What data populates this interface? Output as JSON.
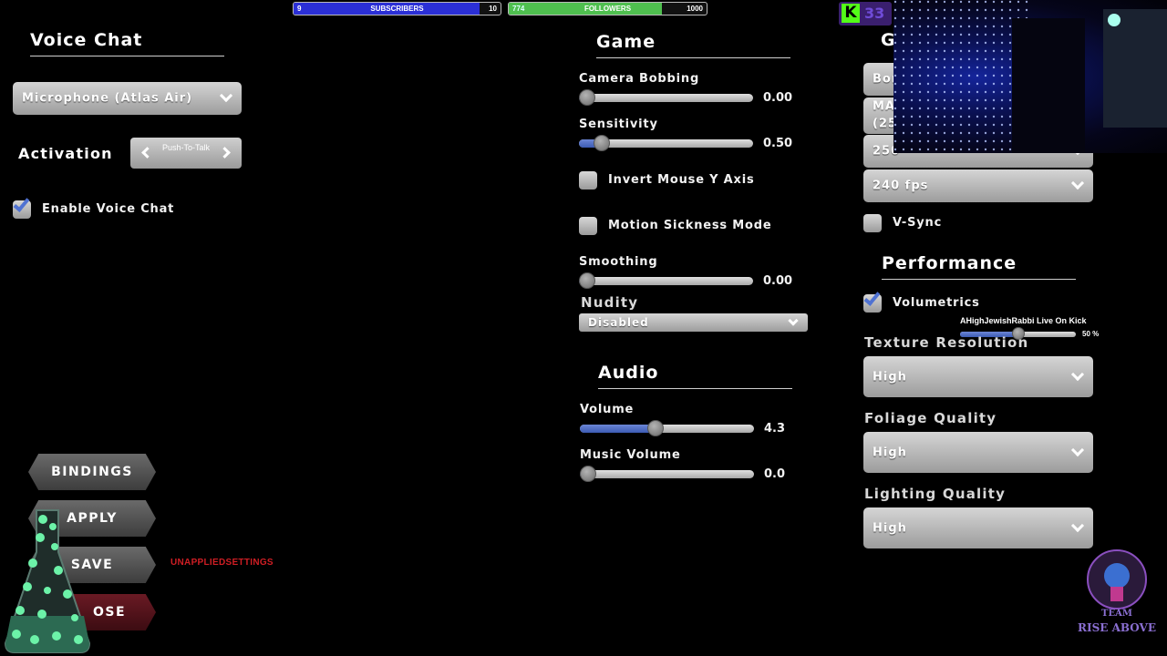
{
  "overlay": {
    "subscribers": {
      "current": "9",
      "label": "SUBSCRIBERS",
      "goal": "10",
      "progress": 0.9,
      "color": "#2b2fd6"
    },
    "followers": {
      "current": "774",
      "label": "FOLLOWERS",
      "goal": "1000",
      "progress": 0.774,
      "color": "#4fbf4f"
    },
    "kick_badge": "K",
    "kick_count": "33",
    "stream_caption": "AHighJewishRabbi Live On Kick",
    "stream_percent": "50 %",
    "stream_progress": 0.5,
    "team_logo": {
      "line1": "TEAM",
      "line2": "RISE ABOVE"
    }
  },
  "voice_chat": {
    "title": "Voice Chat",
    "microphone": "Microphone (Atlas Air)",
    "activation_label": "Activation",
    "activation_value": "Push-To-Talk",
    "enable_label": "Enable Voice Chat",
    "enable_checked": true
  },
  "game": {
    "title": "Game",
    "camera_bobbing": {
      "label": "Camera Bobbing",
      "value": "0.00",
      "fraction": 0.0
    },
    "sensitivity": {
      "label": "Sensitivity",
      "value": "0.50",
      "fraction": 0.09
    },
    "invert_mouse": {
      "label": "Invert Mouse Y Axis",
      "checked": false
    },
    "motion_sickness": {
      "label": "Motion Sickness Mode",
      "checked": false
    },
    "smoothing": {
      "label": "Smoothing",
      "value": "0.00",
      "fraction": 0.0
    },
    "nudity": {
      "label": "Nudity",
      "value": "Disabled"
    }
  },
  "audio": {
    "title": "Audio",
    "volume": {
      "label": "Volume",
      "value": "4.3",
      "fraction": 0.43
    },
    "music_volume": {
      "label": "Music Volume",
      "value": "0.0",
      "fraction": 0.0
    }
  },
  "graphics": {
    "title_partial": "G",
    "dropdown1_partial": "Bor",
    "dropdown2_partial_line1": "MA",
    "dropdown2_partial_line2": "(25",
    "dropdown3_partial": "250",
    "fps": "240 fps",
    "vsync": {
      "label": "V-Sync",
      "checked": false
    }
  },
  "performance": {
    "title": "Performance",
    "volumetrics": {
      "label": "Volumetrics",
      "checked": true
    },
    "texture_resolution": {
      "label": "Texture Resolution",
      "value": "High"
    },
    "foliage_quality": {
      "label": "Foliage Quality",
      "value": "High"
    },
    "lighting_quality": {
      "label": "Lighting Quality",
      "value": "High"
    }
  },
  "buttons": {
    "bindings": "BINDINGS",
    "apply": "APPLY",
    "save": "SAVE",
    "close": "OSE"
  },
  "unapplied_warning": "UNAPPLIEDSETTINGS",
  "colors": {
    "slider_fill": "#4f72d2",
    "warning": "#d01e24",
    "close_button": "#5a1520"
  }
}
